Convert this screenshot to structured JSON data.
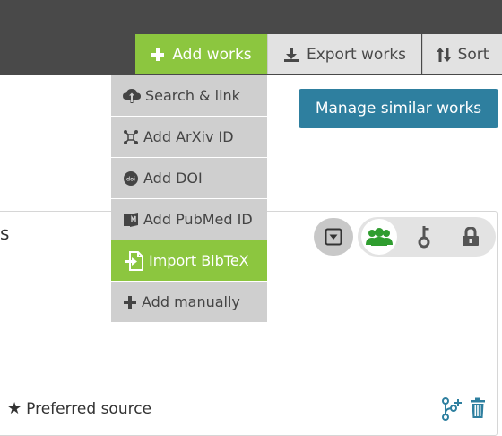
{
  "toolbar": {
    "add_works_label": "Add works",
    "export_works_label": "Export works",
    "sort_label": "Sort"
  },
  "add_menu": {
    "items": [
      {
        "label": "Search & link",
        "icon": "cloud-upload-icon"
      },
      {
        "label": "Add ArXiv ID",
        "icon": "arxiv-icon"
      },
      {
        "label": "Add DOI",
        "icon": "doi-icon"
      },
      {
        "label": "Add PubMed ID",
        "icon": "pubmed-icon"
      },
      {
        "label": "Import BibTeX",
        "icon": "import-icon",
        "active": true
      },
      {
        "label": "Add manually",
        "icon": "plus-icon"
      }
    ]
  },
  "manage_similar_label": "Manage similar works",
  "work_card": {
    "title_fragment": "s",
    "preferred_source_label": "Preferred source",
    "visibility_options": [
      "everyone-icon",
      "trusted-parties-icon",
      "private-lock-icon"
    ],
    "selected_visibility": "everyone"
  },
  "colors": {
    "toolbar_bg": "#494949",
    "accent_green": "#8cc63f",
    "manage_button_bg": "#2e7f9f",
    "menu_item_bg": "#cfcfcf",
    "action_icon_blue": "#2e7f9f"
  }
}
